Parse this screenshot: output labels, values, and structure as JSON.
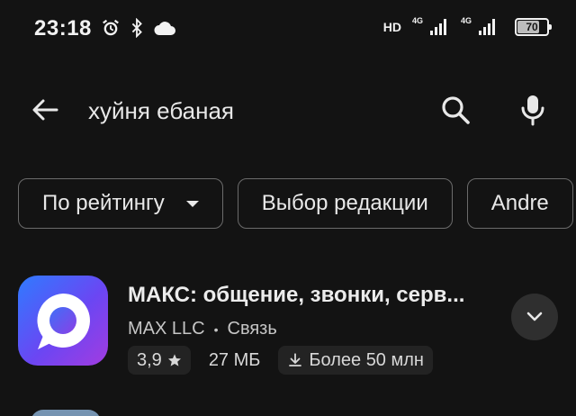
{
  "status_bar": {
    "time": "23:18",
    "hd": "HD",
    "net1": "4G",
    "net2": "4G",
    "battery": "70",
    "icons": [
      "alarm-icon",
      "bluetooth-icon",
      "cloud-icon"
    ]
  },
  "search": {
    "query": "хуйня ебаная"
  },
  "chips": [
    {
      "label": "По рейтингу"
    },
    {
      "label": "Выбор редакции"
    },
    {
      "label": "Andre"
    }
  ],
  "app": {
    "title": "МАКС: общение, звонки, серв...",
    "developer": "MAX LLC",
    "separator": "•",
    "category": "Связь",
    "rating": "3,9",
    "size": "27 МБ",
    "downloads": "Более 50 млн"
  },
  "colors": {
    "background": "#131313",
    "icon_gradient_start": "#2f7bff",
    "icon_gradient_end": "#a23ce0"
  }
}
